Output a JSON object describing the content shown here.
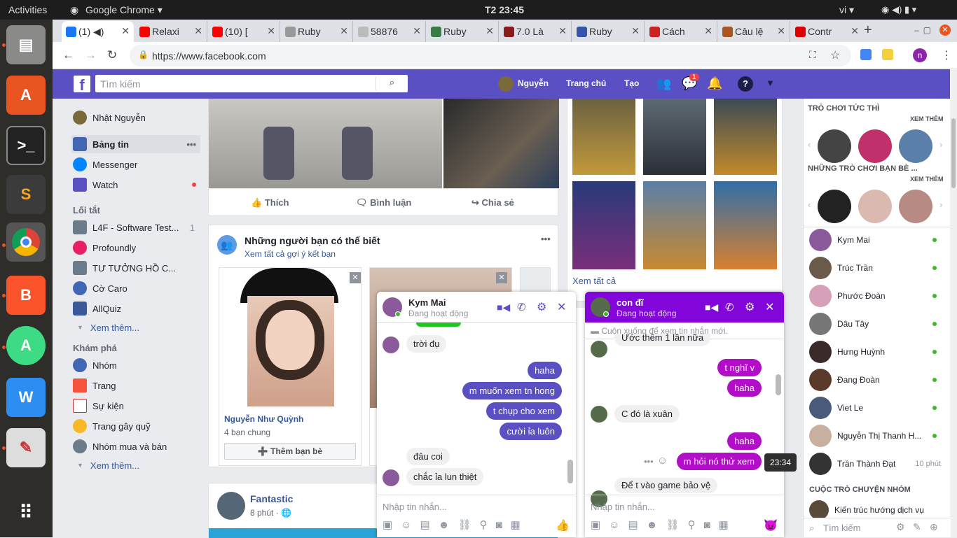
{
  "os": {
    "activities": "Activities",
    "app_menu": "Google Chrome ▾",
    "clock": "T2 23:45",
    "lang": "vi ▾"
  },
  "tabs": [
    {
      "label": "(1) ◀)",
      "color": "#1877f2"
    },
    {
      "label": "Relaxi",
      "color": "#ff0000"
    },
    {
      "label": "(10) [",
      "color": "#ff0000"
    },
    {
      "label": "Ruby",
      "color": "#888888"
    },
    {
      "label": "58876",
      "color": "#888888"
    },
    {
      "label": "Ruby",
      "color": "#3a7d44"
    },
    {
      "label": "7.0 Là",
      "color": "#8b1a1a"
    },
    {
      "label": "Ruby",
      "color": "#3355aa"
    },
    {
      "label": "Cách",
      "color": "#cc2222"
    },
    {
      "label": "Câu lệ",
      "color": "#aa5522"
    },
    {
      "label": "Contr",
      "color": "#dd0000"
    }
  ],
  "url": "https://www.facebook.com",
  "fb": {
    "search_placeholder": "Tìm kiếm",
    "user": "Nguyễn",
    "home": "Trang chủ",
    "create": "Tạo",
    "msg_badge": "1"
  },
  "nav": {
    "profile": "Nhật Nguyễn",
    "main": [
      {
        "label": "Bảng tin"
      },
      {
        "label": "Messenger"
      },
      {
        "label": "Watch"
      }
    ],
    "shortcuts_title": "Lối tắt",
    "shortcuts": [
      {
        "label": "L4F - Software Test...",
        "count": "1"
      },
      {
        "label": "Profoundly"
      },
      {
        "label": "TƯ TƯỞNG HỒ C..."
      },
      {
        "label": "Cờ Caro"
      },
      {
        "label": "AllQuiz"
      }
    ],
    "see_more": "Xem thêm...",
    "explore_title": "Khám phá",
    "explore": [
      {
        "label": "Nhóm"
      },
      {
        "label": "Trang"
      },
      {
        "label": "Sự kiện"
      },
      {
        "label": "Trang gây quỹ"
      },
      {
        "label": "Nhóm mua và bán"
      }
    ],
    "see_more2": "Xem thêm..."
  },
  "post": {
    "like": "Thích",
    "comment": "Bình luận",
    "share": "Chia sẻ"
  },
  "pymk": {
    "title": "Những người bạn có thể biết",
    "subtitle": "Xem tất cả gợi ý kết bạn",
    "person": "Nguyễn Như Quỳnh",
    "mutual": "4 bạn chung",
    "add": "Thêm bạn bè"
  },
  "page_post": {
    "name": "Fantastic",
    "time": "8 phút · "
  },
  "games": {
    "see_all": "Xem tất cả"
  },
  "right": {
    "instant": "TRÒ CHƠI TỨC THÌ",
    "see_more": "XEM THÊM",
    "friends_games": "NHỮNG TRÒ CHƠI BẠN BÈ ...",
    "see_more2": "XEM THÊM",
    "contacts": [
      {
        "name": "Kym Mai",
        "status": "online"
      },
      {
        "name": "Trúc Trần",
        "status": "online"
      },
      {
        "name": "Phước Đoàn",
        "status": "online"
      },
      {
        "name": "Dâu Tây",
        "status": "online"
      },
      {
        "name": "Hưng Huỳnh",
        "status": "online"
      },
      {
        "name": "Đang Đoàn",
        "status": "online"
      },
      {
        "name": "Viet Le",
        "status": "online"
      },
      {
        "name": "Nguyễn Thị Thanh H...",
        "status": "online"
      },
      {
        "name": "Trần Thành Đạt",
        "status": "10 phút"
      }
    ],
    "group_title": "CUỘC TRÒ CHUYỆN NHÓM",
    "group": "Kiến trúc hướng dịch vụ",
    "search": "Tìm kiếm"
  },
  "chat1": {
    "name": "Kym Mai",
    "status": "Đang hoạt động",
    "messages": [
      "trời đụ",
      "haha",
      "m muốn xem tn hong",
      "t chụp cho xem",
      "cười ỉa luôn",
      "đâu coi",
      "chắc ỉa lun thiệt"
    ],
    "input": "Nhập tin nhắn..."
  },
  "chat2": {
    "name": "con đĩ",
    "status": "Đang hoạt động",
    "scroll_hint": "Cuộn xuống để xem tin nhắn mới.",
    "messages": [
      "Ước thêm 1 lần nữa",
      "t nghĩ v",
      "haha",
      "C đó là xuân",
      "haha",
      "m hỏi nó thử xem",
      "Để t vào game bảo vệ"
    ],
    "tooltip": "23:34",
    "input": "Nhập tin nhắn..."
  }
}
